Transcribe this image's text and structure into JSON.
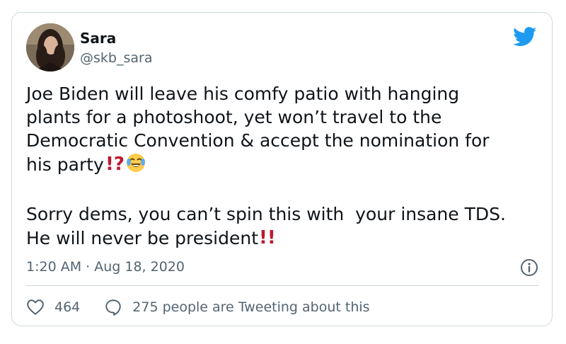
{
  "tweet": {
    "author_name": "Sara",
    "author_handle": "@skb_sara",
    "body_line_1": "Joe Biden will leave his comfy patio with hanging\nplants for a photoshoot, yet won’t travel to the\nDemocratic Convention & accept the nomination for\nhis party",
    "body_emoji_1": "⁉️",
    "body_emoji_2": "😂",
    "body_line_2": "\n\nSorry dems, you can’t spin this with  your insane TDS.\nHe will never be president",
    "body_emoji_3": "‼️",
    "timestamp": "1:20 AM · Aug 18, 2020",
    "like_count": "464",
    "reply_text": "275 people are Tweeting about this"
  },
  "icons": {
    "brand": "twitter-bird-icon",
    "info": "info-icon",
    "like": "heart-icon",
    "reply": "speech-bubble-icon"
  },
  "colors": {
    "brand": "#1d9bf0",
    "text": "#0f1419",
    "secondary": "#536471",
    "emoji_red": "#be1931"
  }
}
